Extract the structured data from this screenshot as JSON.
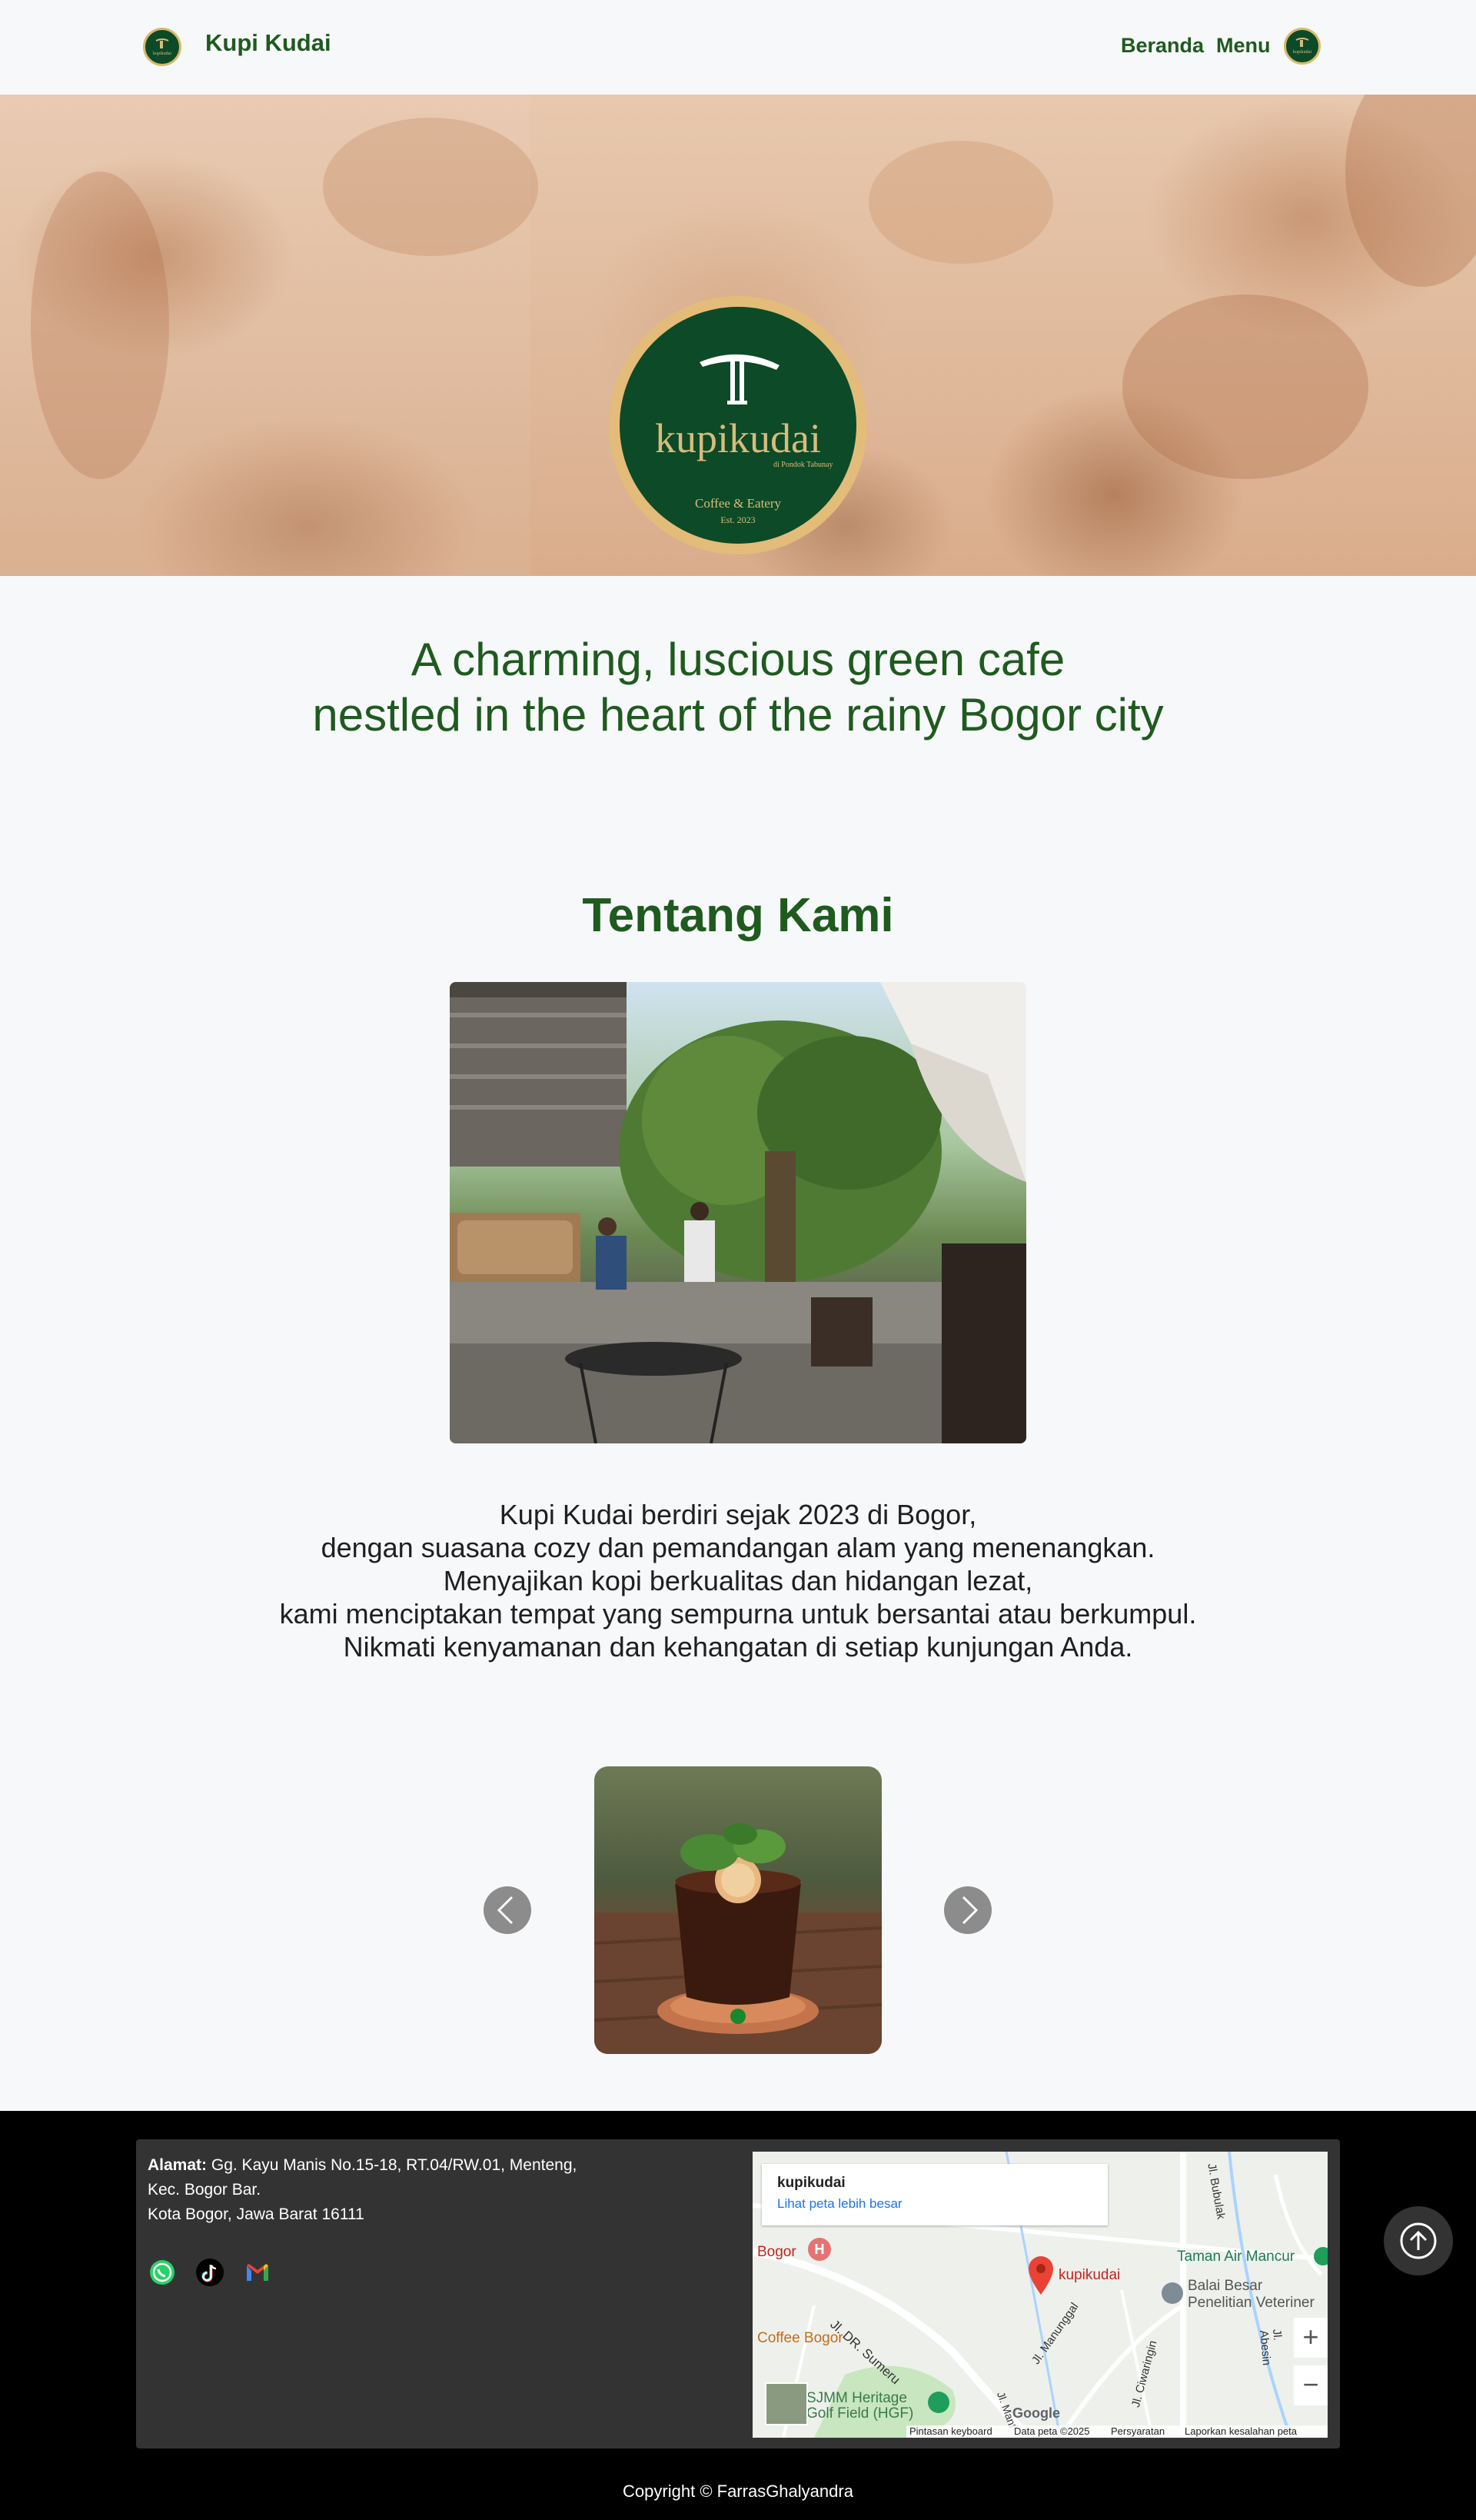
{
  "nav": {
    "brand": "Kupi Kudai",
    "links": [
      "Beranda",
      "Menu"
    ]
  },
  "hero": {
    "logo_word": "kupikudai",
    "logo_sub": "di Pondok Tabunay",
    "logo_tagline": "Coffee & Eatery",
    "logo_est": "Est. 2023"
  },
  "tagline": {
    "line1": "A charming, luscious green cafe",
    "line2": "nestled in the heart of the rainy Bogor city"
  },
  "about": {
    "title": "Tentang Kami",
    "lines": [
      "Kupi Kudai berdiri sejak 2023 di Bogor,",
      "dengan suasana cozy dan pemandangan alam yang menenangkan.",
      "Menyajikan kopi berkualitas dan hidangan lezat,",
      "kami menciptakan tempat yang sempurna untuk bersantai atau berkumpul.",
      "Nikmati kenyamanan dan kehangatan di setiap kunjungan Anda."
    ]
  },
  "footer": {
    "address_label": "Alamat:",
    "address_line1": "Gg. Kayu Manis No.15-18, RT.04/RW.01, Menteng,",
    "address_line2": "Kec. Bogor Bar.",
    "address_line3": "Kota Bogor, Jawa Barat 16111",
    "social_icons": [
      "whatsapp-icon",
      "tiktok-icon",
      "gmail-icon"
    ],
    "copyright": "Copyright © FarrasGhalyandra"
  },
  "map": {
    "place_name": "kupikudai",
    "view_larger": "Lihat peta lebih besar",
    "marker_label": "kupikudai",
    "labels": {
      "bogor": "Bogor",
      "coffee_bogor": "Coffee Bogor",
      "taman_air": "Taman Air Mancur",
      "balai": "Balai Besar",
      "balai2": "Penelitian Veteriner",
      "sjmm": "SJMM Heritage",
      "sjmm2": "Golf Field (HGF)",
      "jl_sumeru": "Jl. DR. Sumeru",
      "jl_manunggal": "Jl. Manunggal",
      "jl_ciwaringin": "Jl. Ciwaringin",
      "jl_bubulak": "Jl. Bubulak",
      "jl_abesin": "Jl. Abesin",
      "jl_mant": "Jl. Mant",
      "google": "Google"
    },
    "zoom_in": "+",
    "zoom_out": "−",
    "footer": {
      "keyboard": "Pintasan keyboard",
      "data": "Data peta ©2025",
      "terms": "Persyaratan",
      "report": "Laporkan kesalahan peta"
    }
  },
  "colors": {
    "brand_green": "#1f5a1f",
    "logo_green": "#0d4a27",
    "gold": "#d8bb7c",
    "footer_bg": "#000000",
    "card_bg": "#333333"
  }
}
